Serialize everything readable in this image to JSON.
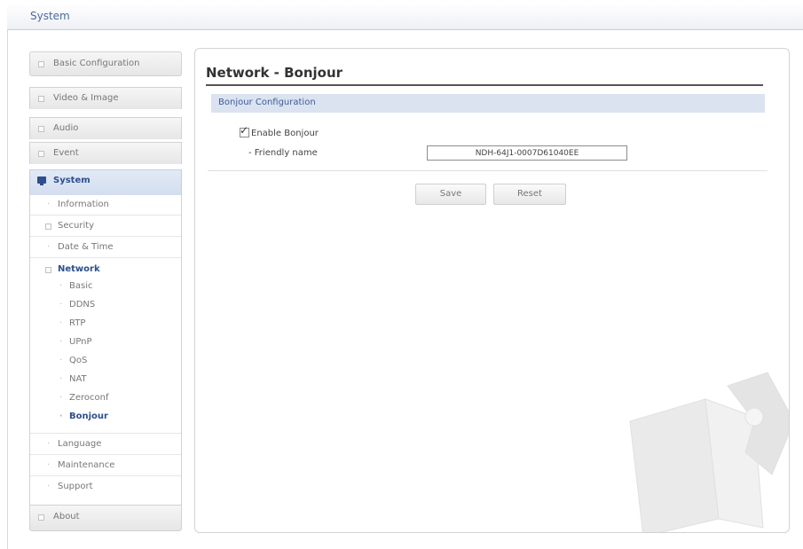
{
  "header": {
    "title": "System"
  },
  "sidebar": {
    "basic_configuration": "Basic Configuration",
    "video_image": "Video & Image",
    "audio": "Audio",
    "event": "Event",
    "system": "System",
    "system_items": {
      "information": "Information",
      "security": "Security",
      "date_time": "Date & Time",
      "network": "Network",
      "language": "Language",
      "maintenance": "Maintenance",
      "support": "Support"
    },
    "network_items": [
      "Basic",
      "DDNS",
      "RTP",
      "UPnP",
      "QoS",
      "NAT",
      "Zeroconf",
      "Bonjour"
    ],
    "about": "About"
  },
  "main": {
    "page_title": "Network - Bonjour",
    "section_title": "Bonjour Configuration",
    "enable_bonjour": {
      "label": "Enable Bonjour",
      "checked": true,
      "check_glyph": "✓"
    },
    "friendly_name": {
      "label": "- Friendly name",
      "value": "NDH-64J1-0007D61040EE"
    },
    "save_label": "Save",
    "reset_label": "Reset"
  }
}
